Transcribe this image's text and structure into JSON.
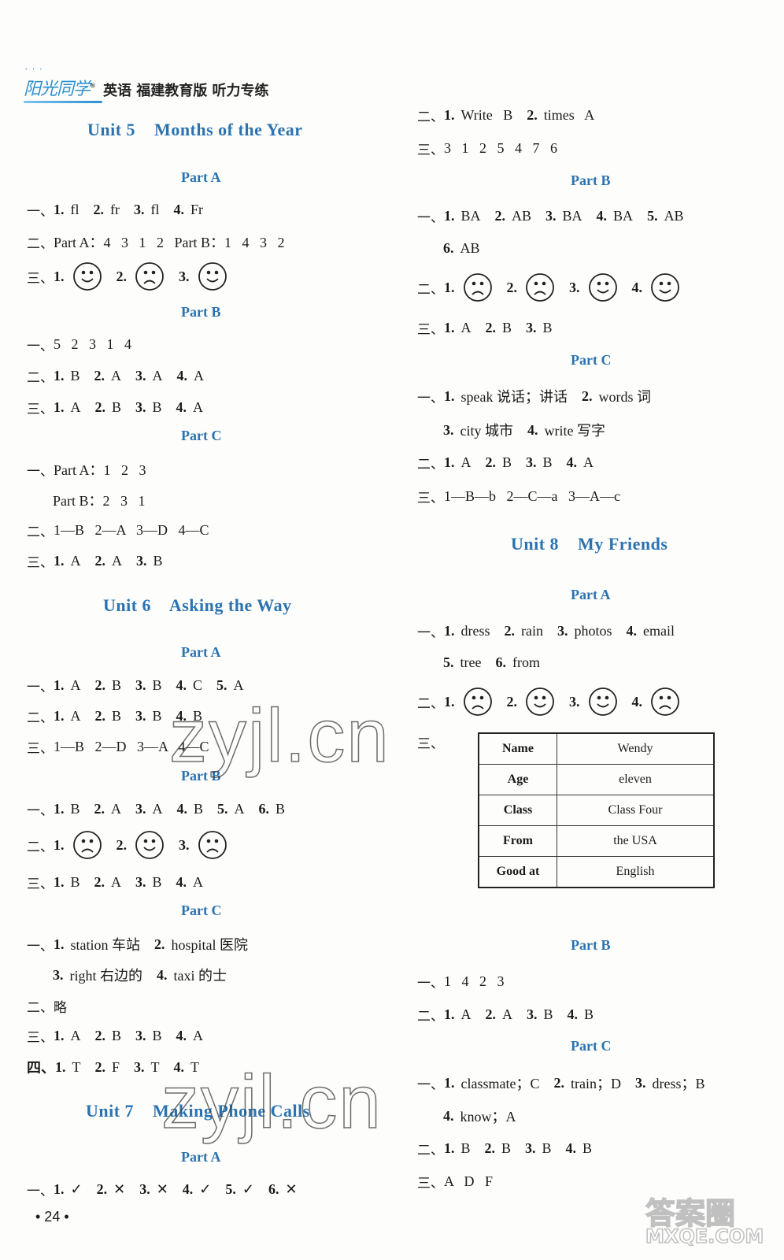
{
  "header": {
    "logo": "阳光同学",
    "title": "英语 福建教育版 听力专练"
  },
  "left": {
    "unit5": {
      "title": "Unit 5    Months of the Year",
      "partA": {
        "title": "Part A",
        "q1": {
          "label": "一、",
          "items": [
            [
              "1.",
              "fl"
            ],
            [
              "2.",
              "fr"
            ],
            [
              "3.",
              "fl"
            ],
            [
              "4.",
              "Fr"
            ]
          ]
        },
        "q2": {
          "label": "二、",
          "text": "Part A：4   3   1   2   Part B：1   4   3   2"
        },
        "q3": {
          "label": "三、",
          "faces": [
            "happy",
            "sad",
            "happy"
          ]
        }
      },
      "partB": {
        "title": "Part B",
        "q1": {
          "label": "一、",
          "text": "5   2   3   1   4"
        },
        "q2": {
          "label": "二、",
          "items": [
            [
              "1.",
              "B"
            ],
            [
              "2.",
              "A"
            ],
            [
              "3.",
              "A"
            ],
            [
              "4.",
              "A"
            ]
          ]
        },
        "q3": {
          "label": "三、",
          "items": [
            [
              "1.",
              "A"
            ],
            [
              "2.",
              "B"
            ],
            [
              "3.",
              "B"
            ],
            [
              "4.",
              "A"
            ]
          ]
        }
      },
      "partC": {
        "title": "Part C",
        "q1": {
          "label": "一、",
          "text": "Part A：1   2   3",
          "text2": "Part B：2   3   1"
        },
        "q2": {
          "label": "二、",
          "text": "1—B   2—A   3—D   4—C"
        },
        "q3": {
          "label": "三、",
          "items": [
            [
              "1.",
              "A"
            ],
            [
              "2.",
              "A"
            ],
            [
              "3.",
              "B"
            ]
          ]
        }
      }
    },
    "unit6": {
      "title": "Unit 6    Asking the Way",
      "partA": {
        "title": "Part A",
        "q1": {
          "label": "一、",
          "items": [
            [
              "1.",
              "A"
            ],
            [
              "2.",
              "B"
            ],
            [
              "3.",
              "B"
            ],
            [
              "4.",
              "C"
            ],
            [
              "5.",
              "A"
            ]
          ]
        },
        "q2": {
          "label": "二、",
          "items": [
            [
              "1.",
              "A"
            ],
            [
              "2.",
              "B"
            ],
            [
              "3.",
              "B"
            ],
            [
              "4.",
              "B"
            ]
          ]
        },
        "q3": {
          "label": "三、",
          "text": "1—B   2—D   3—A   4—C"
        }
      },
      "partB": {
        "title": "Part B",
        "q1": {
          "label": "一、",
          "items": [
            [
              "1.",
              "B"
            ],
            [
              "2.",
              "A"
            ],
            [
              "3.",
              "A"
            ],
            [
              "4.",
              "B"
            ],
            [
              "5.",
              "A"
            ],
            [
              "6.",
              "B"
            ]
          ]
        },
        "q2": {
          "label": "二、",
          "faces": [
            "sad",
            "happy",
            "sad"
          ]
        },
        "q3": {
          "label": "三、",
          "items": [
            [
              "1.",
              "B"
            ],
            [
              "2.",
              "A"
            ],
            [
              "3.",
              "B"
            ],
            [
              "4.",
              "A"
            ]
          ]
        }
      },
      "partC": {
        "title": "Part C",
        "q1": {
          "label": "一、",
          "items": [
            [
              "1.",
              "station 车站"
            ],
            [
              "2.",
              "hospital 医院"
            ]
          ],
          "items2": [
            [
              "3.",
              "right 右边的"
            ],
            [
              "4.",
              "taxi 的士"
            ]
          ]
        },
        "q2": {
          "label": "二、",
          "text": "略"
        },
        "q3": {
          "label": "三、",
          "items": [
            [
              "1.",
              "A"
            ],
            [
              "2.",
              "B"
            ],
            [
              "3.",
              "B"
            ],
            [
              "4.",
              "A"
            ]
          ]
        },
        "q4": {
          "label": "四、",
          "items": [
            [
              "1.",
              "T"
            ],
            [
              "2.",
              "F"
            ],
            [
              "3.",
              "T"
            ],
            [
              "4.",
              "T"
            ]
          ]
        }
      }
    },
    "unit7": {
      "title": "Unit 7    Making Phone Calls",
      "partA": {
        "title": "Part A",
        "q1": {
          "label": "一、",
          "items": [
            [
              "1.",
              "✓"
            ],
            [
              "2.",
              "✕"
            ],
            [
              "3.",
              "✕"
            ],
            [
              "4.",
              "✓"
            ],
            [
              "5.",
              "✓"
            ],
            [
              "6.",
              "✕"
            ]
          ]
        }
      }
    },
    "page_number": "• 24 •"
  },
  "right": {
    "unit7_cont": {
      "q2": {
        "label": "二、",
        "items": [
          [
            "1.",
            "Write   B"
          ],
          [
            "2.",
            "times   A"
          ]
        ]
      },
      "q3": {
        "label": "三、",
        "text": "3   1   2   5   4   7   6"
      },
      "partB": {
        "title": "Part B",
        "q1": {
          "label": "一、",
          "items": [
            [
              "1.",
              "BA"
            ],
            [
              "2.",
              "AB"
            ],
            [
              "3.",
              "BA"
            ],
            [
              "4.",
              "BA"
            ],
            [
              "5.",
              "AB"
            ]
          ],
          "items2": [
            [
              "6.",
              "AB"
            ]
          ]
        },
        "q2": {
          "label": "二、",
          "faces": [
            "sad",
            "sad",
            "happy",
            "happy"
          ]
        },
        "q3": {
          "label": "三、",
          "items": [
            [
              "1.",
              "A"
            ],
            [
              "2.",
              "B"
            ],
            [
              "3.",
              "B"
            ]
          ]
        }
      },
      "partC": {
        "title": "Part C",
        "q1": {
          "label": "一、",
          "items": [
            [
              "1.",
              "speak 说话；讲话"
            ],
            [
              "2.",
              "words 词"
            ]
          ],
          "items2": [
            [
              "3.",
              "city 城市"
            ],
            [
              "4.",
              "write 写字"
            ]
          ]
        },
        "q2": {
          "label": "二、",
          "items": [
            [
              "1.",
              "A"
            ],
            [
              "2.",
              "B"
            ],
            [
              "3.",
              "B"
            ],
            [
              "4.",
              "A"
            ]
          ]
        },
        "q3": {
          "label": "三、",
          "text": "1—B—b   2—C—a   3—A—c"
        }
      }
    },
    "unit8": {
      "title": "Unit 8    My Friends",
      "partA": {
        "title": "Part A",
        "q1": {
          "label": "一、",
          "items": [
            [
              "1.",
              "dress"
            ],
            [
              "2.",
              "rain"
            ],
            [
              "3.",
              "photos"
            ],
            [
              "4.",
              "email"
            ]
          ],
          "items2": [
            [
              "5.",
              "tree"
            ],
            [
              "6.",
              "from"
            ]
          ]
        },
        "q2": {
          "label": "二、",
          "faces": [
            "sad",
            "happy",
            "happy",
            "sad"
          ]
        },
        "q3": {
          "label": "三、",
          "table": [
            {
              "key": "Name",
              "value": "Wendy"
            },
            {
              "key": "Age",
              "value": "eleven"
            },
            {
              "key": "Class",
              "value": "Class Four"
            },
            {
              "key": "From",
              "value": "the USA"
            },
            {
              "key": "Good at",
              "value": "English"
            }
          ]
        }
      },
      "partB": {
        "title": "Part B",
        "q1": {
          "label": "一、",
          "text": "1   4   2   3"
        },
        "q2": {
          "label": "二、",
          "items": [
            [
              "1.",
              "A"
            ],
            [
              "2.",
              "A"
            ],
            [
              "3.",
              "B"
            ],
            [
              "4.",
              "B"
            ]
          ]
        }
      },
      "partC": {
        "title": "Part C",
        "q1": {
          "label": "一、",
          "items": [
            [
              "1.",
              "classmate；C"
            ],
            [
              "2.",
              "train；D"
            ],
            [
              "3.",
              "dress；B"
            ]
          ],
          "items2": [
            [
              "4.",
              "know；A"
            ]
          ]
        },
        "q2": {
          "label": "二、",
          "items": [
            [
              "1.",
              "B"
            ],
            [
              "2.",
              "B"
            ],
            [
              "3.",
              "B"
            ],
            [
              "4.",
              "B"
            ]
          ]
        },
        "q3": {
          "label": "三、",
          "text": "A   D   F"
        }
      }
    }
  },
  "watermarks": {
    "main": "zyjl.cn",
    "corner": "答案圈",
    "corner_url": "MXQE.COM"
  }
}
